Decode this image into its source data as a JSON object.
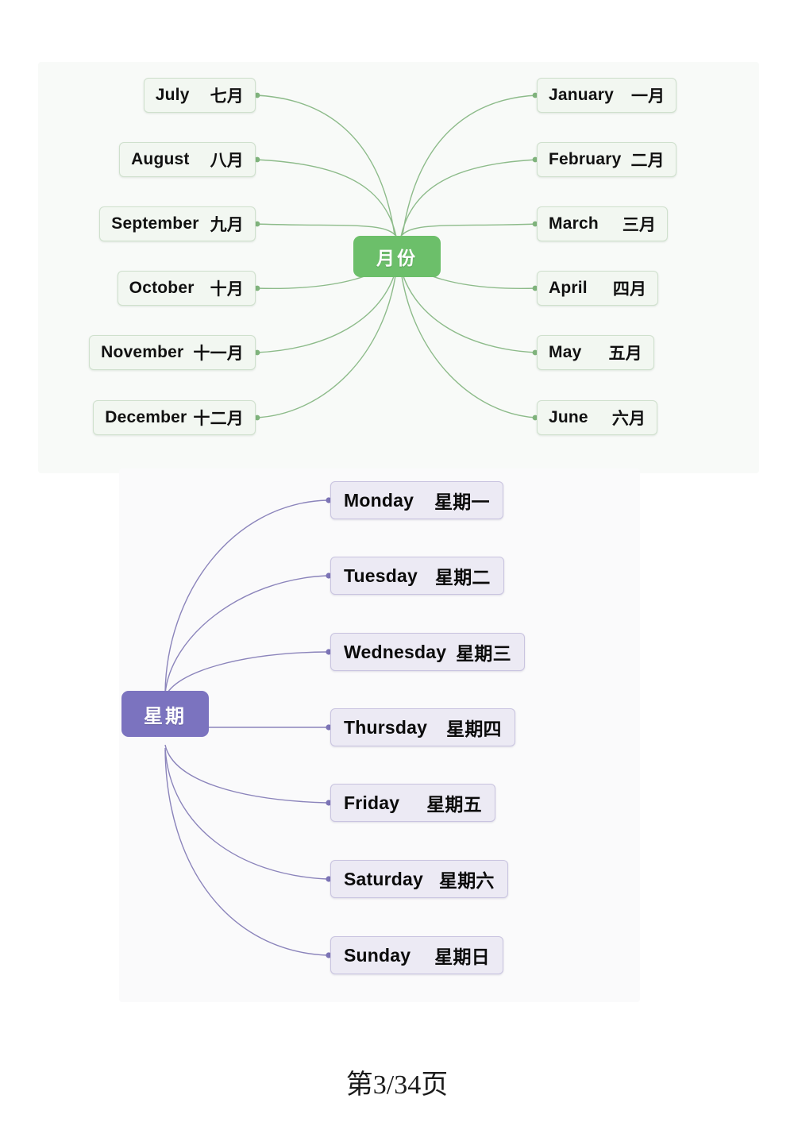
{
  "document": {
    "footer": "第3/34页"
  },
  "colors": {
    "months_panel_bg": "#f8faf8",
    "months_node_bg": "#6cbf6a",
    "months_box_bg": "#f2f7f1",
    "months_box_border": "#cfe0cd",
    "months_connector": "#8dbb8a",
    "weekdays_panel_bg": "#fafafb",
    "weekdays_node_bg": "#7b73bf",
    "weekdays_box_bg": "#eceaf4",
    "weekdays_box_border": "#c9c4e0",
    "weekdays_connector": "#8b84bb",
    "text": "#111111",
    "node_text": "#ffffff"
  },
  "months_map": {
    "center_label": "月份",
    "left_branches": [
      {
        "en": "July",
        "cn": "七月"
      },
      {
        "en": "August",
        "cn": "八月"
      },
      {
        "en": "September",
        "cn": "九月"
      },
      {
        "en": "October",
        "cn": "十月"
      },
      {
        "en": "November",
        "cn": "十一月"
      },
      {
        "en": "December",
        "cn": "十二月"
      }
    ],
    "right_branches": [
      {
        "en": "January",
        "cn": "一月"
      },
      {
        "en": "February",
        "cn": "二月"
      },
      {
        "en": "March",
        "cn": "三月"
      },
      {
        "en": "April",
        "cn": "四月"
      },
      {
        "en": "May",
        "cn": "五月"
      },
      {
        "en": "June",
        "cn": "六月"
      }
    ]
  },
  "weekdays_map": {
    "center_label": "星期",
    "branches": [
      {
        "en": "Monday",
        "cn": "星期一"
      },
      {
        "en": "Tuesday",
        "cn": "星期二"
      },
      {
        "en": "Wednesday",
        "cn": "星期三"
      },
      {
        "en": "Thursday",
        "cn": "星期四"
      },
      {
        "en": "Friday",
        "cn": "星期五"
      },
      {
        "en": "Saturday",
        "cn": "星期六"
      },
      {
        "en": "Sunday",
        "cn": "星期日"
      }
    ]
  }
}
